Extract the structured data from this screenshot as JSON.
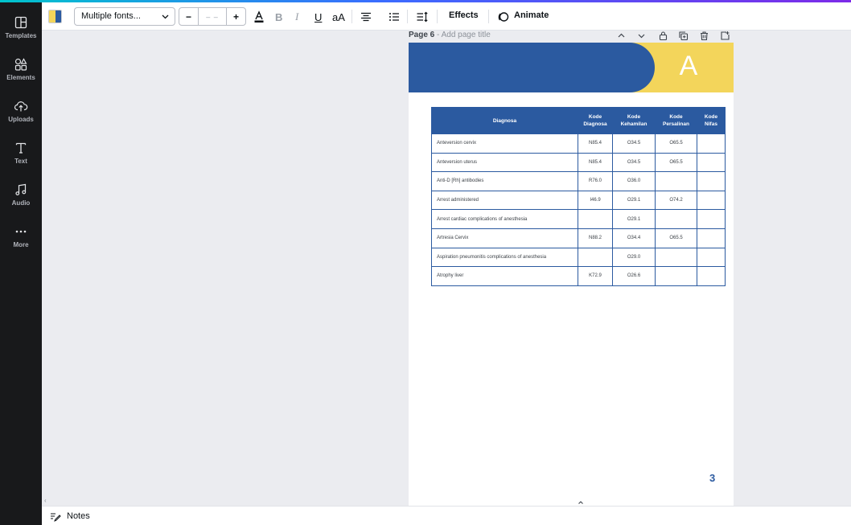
{
  "rail": {
    "items": [
      {
        "label": "Templates",
        "icon": "templates-icon"
      },
      {
        "label": "Elements",
        "icon": "elements-icon"
      },
      {
        "label": "Uploads",
        "icon": "uploads-icon"
      },
      {
        "label": "Text",
        "icon": "text-icon"
      },
      {
        "label": "Audio",
        "icon": "audio-icon"
      },
      {
        "label": "More",
        "icon": "more-icon"
      }
    ]
  },
  "toolbar": {
    "font": "Multiple fonts...",
    "size_minus": "−",
    "size_value": "– –",
    "size_plus": "+",
    "bold": "B",
    "italic": "I",
    "underline": "U",
    "case": "aA",
    "effects": "Effects",
    "animate": "Animate",
    "swatch_colors": [
      "#f3d55b",
      "#2b5aa0"
    ]
  },
  "page": {
    "label": "Page 6",
    "separator": " - ",
    "title_placeholder": "Add page title",
    "banner_letter": "A",
    "page_number": "3"
  },
  "table": {
    "headers": [
      {
        "l1": "Diagnosa",
        "l2": ""
      },
      {
        "l1": "Kode",
        "l2": "Diagnosa"
      },
      {
        "l1": "Kode",
        "l2": "Kehamilan"
      },
      {
        "l1": "Kode",
        "l2": "Persalinan"
      },
      {
        "l1": "Kode",
        "l2": "Nifas"
      }
    ],
    "rows": [
      [
        "Anteversion cervix",
        "N85.4",
        "O34.5",
        "O65.5",
        ""
      ],
      [
        "Anteversion uterus",
        "N85.4",
        "O34.5",
        "O65.5",
        ""
      ],
      [
        "Anti-D [Rh] antibodies",
        "R76.0",
        "O36.0",
        "",
        ""
      ],
      [
        "Arrest administered",
        "I46.9",
        "O29.1",
        "O74.2",
        ""
      ],
      [
        "Arrest cardiac complications of anesthesia",
        "",
        "O29.1",
        "",
        ""
      ],
      [
        "Artresia Cervix",
        "N88.2",
        "O34.4",
        "O65.5",
        ""
      ],
      [
        "Aspiration pneumonitis complications of anesthesia",
        "",
        "O29.0",
        "",
        ""
      ],
      [
        "Atrophy liver",
        "K72.9",
        "O26.6",
        "",
        ""
      ]
    ]
  },
  "bottom": {
    "notes": "Notes",
    "scroll_left": "‹"
  },
  "colors": {
    "brand_blue": "#2b5aa0",
    "brand_yellow": "#f3d55b",
    "rail_bg": "#18191b"
  }
}
